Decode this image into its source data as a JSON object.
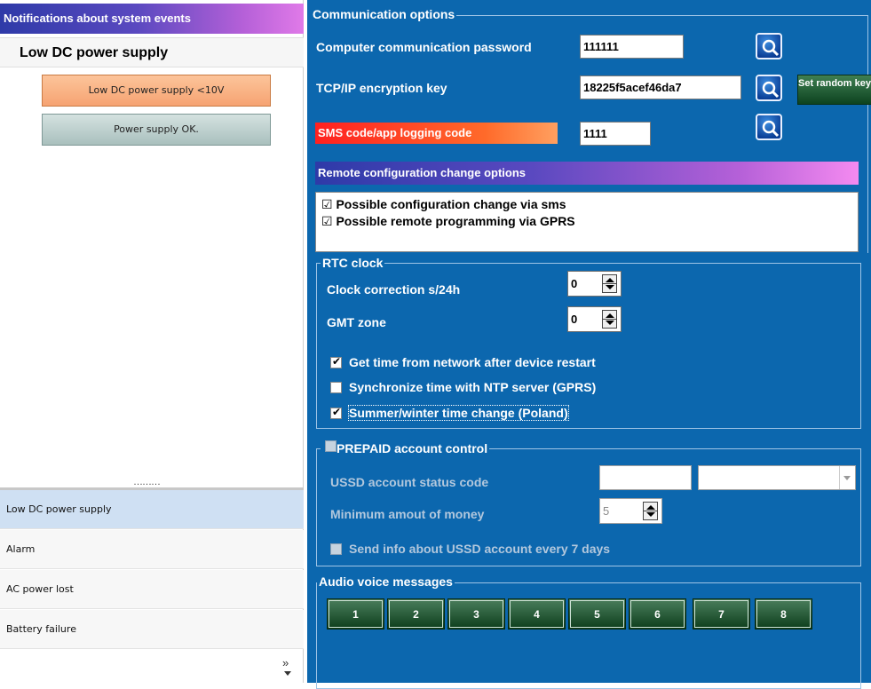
{
  "left": {
    "header": "Notifications about system events",
    "title": "Low DC power supply",
    "buttons": [
      "Low DC power supply <10V",
      "Power supply OK."
    ],
    "splitter_dots": "………",
    "items": [
      "Low DC power supply",
      "Alarm",
      "AC power lost",
      "Battery failure"
    ],
    "more_glyph": "»"
  },
  "comm": {
    "title": "Communication options",
    "password_label": "Computer communication password",
    "password_value": "111111",
    "tcp_label": "TCP/IP encryption key",
    "tcp_value": "18225f5acef46da7",
    "random_key_label": "Set random key",
    "sms_label": "SMS code/app logging code",
    "sms_value": "1111"
  },
  "remote": {
    "title": "Remote configuration change options",
    "opt1": "Possible configuration change via sms",
    "opt2": "Possible remote programming via GPRS"
  },
  "rtc": {
    "title": "RTC clock",
    "correction_label": "Clock correction s/24h",
    "correction_value": "0",
    "gmt_label": "GMT zone",
    "gmt_value": "0",
    "cb1": "Get time from network after device restart",
    "cb2": "Synchronize time with NTP server (GPRS)",
    "cb3": "Summer/winter time change (Poland)"
  },
  "prepaid": {
    "title": "PREPAID account control",
    "ussd_label": "USSD account status code",
    "money_label": "Minimum amout of money",
    "money_value": "5",
    "cb": "Send info about USSD account every 7 days"
  },
  "audio": {
    "title": "Audio voice messages",
    "buttons": [
      "1",
      "2",
      "3",
      "4",
      "5",
      "6",
      "7",
      "8"
    ]
  },
  "colors": {
    "panel_bg": "#0c67ae",
    "gradient_end": "#e07ae8",
    "sms_red": "#ff2020",
    "button_green": "#0d4320"
  },
  "icons": {
    "search": "magnifier-icon",
    "more": "double-chevron-icon"
  }
}
